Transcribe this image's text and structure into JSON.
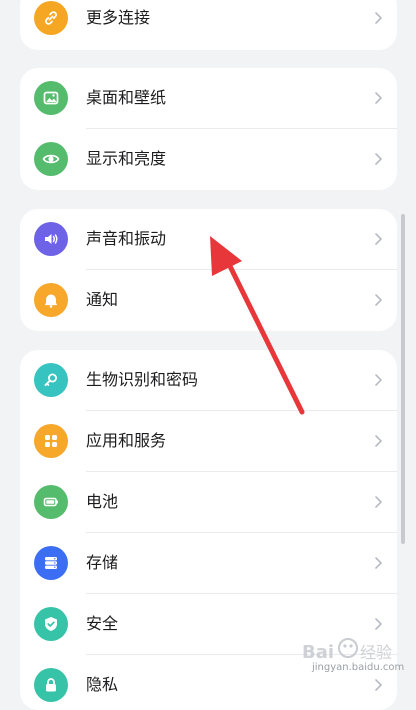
{
  "colors": {
    "background": "#f1f3f5",
    "card": "#ffffff",
    "arrow": "#e8373a"
  },
  "groups": [
    {
      "items": [
        {
          "label": "更多连接",
          "icon": "link-icon",
          "icon_color": "#f5a623"
        }
      ]
    },
    {
      "items": [
        {
          "label": "桌面和壁纸",
          "icon": "image-icon",
          "icon_color": "#55bb6d"
        },
        {
          "label": "显示和亮度",
          "icon": "eye-icon",
          "icon_color": "#55bb6d"
        }
      ]
    },
    {
      "items": [
        {
          "label": "声音和振动",
          "icon": "speaker-icon",
          "icon_color": "#6e63e6"
        },
        {
          "label": "通知",
          "icon": "bell-icon",
          "icon_color": "#f7a72a"
        }
      ]
    },
    {
      "items": [
        {
          "label": "生物识别和密码",
          "icon": "key-icon",
          "icon_color": "#37c3c0"
        },
        {
          "label": "应用和服务",
          "icon": "apps-grid-icon",
          "icon_color": "#f7a72a"
        },
        {
          "label": "电池",
          "icon": "battery-icon",
          "icon_color": "#55bb6d"
        },
        {
          "label": "存储",
          "icon": "storage-icon",
          "icon_color": "#3b6ef2"
        },
        {
          "label": "安全",
          "icon": "shield-check-icon",
          "icon_color": "#37c3a8"
        },
        {
          "label": "隐私",
          "icon": "privacy-lock-icon",
          "icon_color": "#37c3a8"
        }
      ]
    }
  ],
  "watermark": {
    "logo": "Baidu经验",
    "url": "jingyan.baidu.com"
  }
}
